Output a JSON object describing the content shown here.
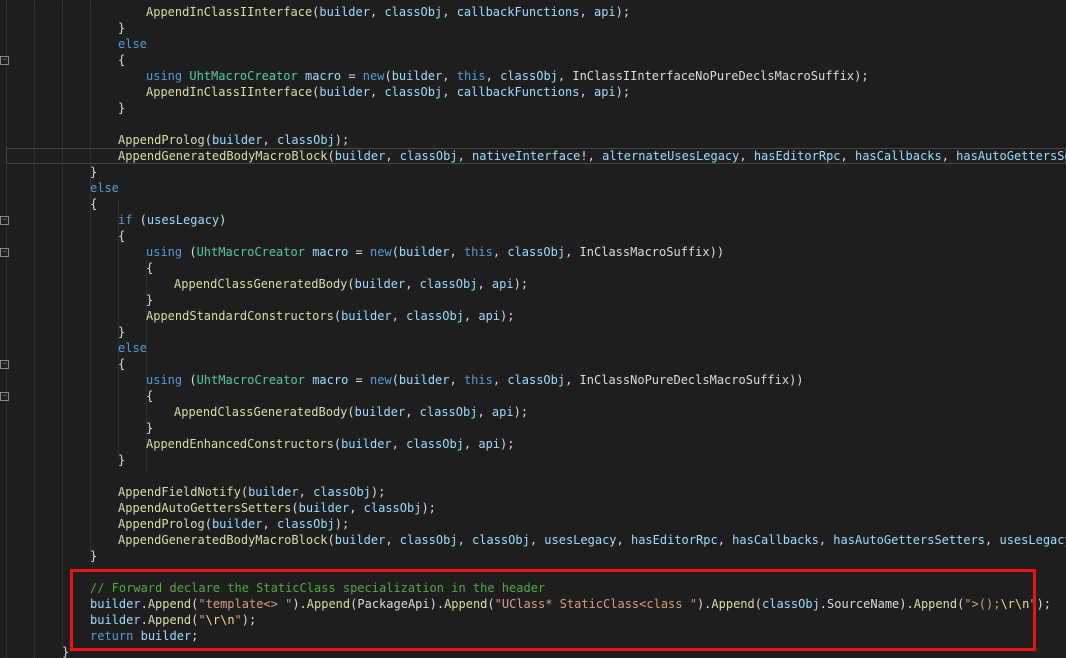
{
  "editor": {
    "lines": [
      {
        "indent": 34,
        "tokens": [
          {
            "t": "AppendInClassIInterface",
            "c": "fn"
          },
          {
            "t": "(",
            "c": "pl"
          },
          {
            "t": "builder",
            "c": "vr"
          },
          {
            "t": ", ",
            "c": "pl"
          },
          {
            "t": "classObj",
            "c": "vr"
          },
          {
            "t": ", ",
            "c": "pl"
          },
          {
            "t": "callbackFunctions",
            "c": "vr"
          },
          {
            "t": ", ",
            "c": "pl"
          },
          {
            "t": "api",
            "c": "vr"
          },
          {
            "t": ");",
            "c": "pl"
          }
        ]
      },
      {
        "indent": 30,
        "tokens": [
          {
            "t": "}",
            "c": "pl"
          }
        ]
      },
      {
        "indent": 30,
        "tokens": [
          {
            "t": "else",
            "c": "kw"
          }
        ]
      },
      {
        "indent": 30,
        "tokens": [
          {
            "t": "{",
            "c": "pl"
          }
        ]
      },
      {
        "indent": 34,
        "tokens": [
          {
            "t": "using ",
            "c": "kw"
          },
          {
            "t": "UhtMacroCreator",
            "c": "ty"
          },
          {
            "t": " ",
            "c": "pl"
          },
          {
            "t": "macro",
            "c": "vr"
          },
          {
            "t": " = ",
            "c": "pl"
          },
          {
            "t": "new",
            "c": "kw"
          },
          {
            "t": "(",
            "c": "pl"
          },
          {
            "t": "builder",
            "c": "vr"
          },
          {
            "t": ", ",
            "c": "pl"
          },
          {
            "t": "this",
            "c": "kw"
          },
          {
            "t": ", ",
            "c": "pl"
          },
          {
            "t": "classObj",
            "c": "vr"
          },
          {
            "t": ", InClassIInterfaceNoPureDeclsMacroSuffix);",
            "c": "pl"
          }
        ]
      },
      {
        "indent": 34,
        "tokens": [
          {
            "t": "AppendInClassIInterface",
            "c": "fn"
          },
          {
            "t": "(",
            "c": "pl"
          },
          {
            "t": "builder",
            "c": "vr"
          },
          {
            "t": ", ",
            "c": "pl"
          },
          {
            "t": "classObj",
            "c": "vr"
          },
          {
            "t": ", ",
            "c": "pl"
          },
          {
            "t": "callbackFunctions",
            "c": "vr"
          },
          {
            "t": ", ",
            "c": "pl"
          },
          {
            "t": "api",
            "c": "vr"
          },
          {
            "t": ");",
            "c": "pl"
          }
        ]
      },
      {
        "indent": 30,
        "tokens": [
          {
            "t": "}",
            "c": "pl"
          }
        ]
      },
      {
        "indent": 0,
        "tokens": []
      },
      {
        "indent": 30,
        "tokens": [
          {
            "t": "AppendProlog",
            "c": "fn"
          },
          {
            "t": "(",
            "c": "pl"
          },
          {
            "t": "builder",
            "c": "vr"
          },
          {
            "t": ", ",
            "c": "pl"
          },
          {
            "t": "classObj",
            "c": "vr"
          },
          {
            "t": ");",
            "c": "pl"
          }
        ]
      },
      {
        "indent": 30,
        "current": true,
        "tokens": [
          {
            "t": "AppendGeneratedBodyMacroBlock",
            "c": "fn"
          },
          {
            "t": "(",
            "c": "pl"
          },
          {
            "t": "builder",
            "c": "vr"
          },
          {
            "t": ", ",
            "c": "pl"
          },
          {
            "t": "classObj",
            "c": "vr"
          },
          {
            "t": ", ",
            "c": "pl"
          },
          {
            "t": "nativeInterface",
            "c": "vr"
          },
          {
            "t": "!, ",
            "c": "pl"
          },
          {
            "t": "alternateUsesLegacy",
            "c": "vr"
          },
          {
            "t": ", ",
            "c": "pl"
          },
          {
            "t": "hasEditorRpc",
            "c": "vr"
          },
          {
            "t": ", ",
            "c": "pl"
          },
          {
            "t": "hasCallbacks",
            "c": "vr"
          },
          {
            "t": ", ",
            "c": "pl"
          },
          {
            "t": "hasAutoGettersSetters",
            "c": "vr"
          }
        ]
      },
      {
        "indent": 26,
        "tokens": [
          {
            "t": "}",
            "c": "pl"
          }
        ]
      },
      {
        "indent": 26,
        "tokens": [
          {
            "t": "else",
            "c": "kw"
          }
        ]
      },
      {
        "indent": 26,
        "tokens": [
          {
            "t": "{",
            "c": "pl"
          }
        ]
      },
      {
        "indent": 30,
        "tokens": [
          {
            "t": "if",
            "c": "kw"
          },
          {
            "t": " (",
            "c": "pl"
          },
          {
            "t": "usesLegacy",
            "c": "vr"
          },
          {
            "t": ")",
            "c": "pl"
          }
        ]
      },
      {
        "indent": 30,
        "tokens": [
          {
            "t": "{",
            "c": "pl"
          }
        ]
      },
      {
        "indent": 34,
        "tokens": [
          {
            "t": "using",
            "c": "kw"
          },
          {
            "t": " (",
            "c": "pl"
          },
          {
            "t": "UhtMacroCreator",
            "c": "ty"
          },
          {
            "t": " ",
            "c": "pl"
          },
          {
            "t": "macro",
            "c": "vr"
          },
          {
            "t": " = ",
            "c": "pl"
          },
          {
            "t": "new",
            "c": "kw"
          },
          {
            "t": "(",
            "c": "pl"
          },
          {
            "t": "builder",
            "c": "vr"
          },
          {
            "t": ", ",
            "c": "pl"
          },
          {
            "t": "this",
            "c": "kw"
          },
          {
            "t": ", ",
            "c": "pl"
          },
          {
            "t": "classObj",
            "c": "vr"
          },
          {
            "t": ", InClassMacroSuffix))",
            "c": "pl"
          }
        ]
      },
      {
        "indent": 34,
        "tokens": [
          {
            "t": "{",
            "c": "pl"
          }
        ]
      },
      {
        "indent": 38,
        "tokens": [
          {
            "t": "AppendClassGeneratedBody",
            "c": "fn"
          },
          {
            "t": "(",
            "c": "pl"
          },
          {
            "t": "builder",
            "c": "vr"
          },
          {
            "t": ", ",
            "c": "pl"
          },
          {
            "t": "classObj",
            "c": "vr"
          },
          {
            "t": ", ",
            "c": "pl"
          },
          {
            "t": "api",
            "c": "vr"
          },
          {
            "t": ");",
            "c": "pl"
          }
        ]
      },
      {
        "indent": 34,
        "tokens": [
          {
            "t": "}",
            "c": "pl"
          }
        ]
      },
      {
        "indent": 34,
        "tokens": [
          {
            "t": "AppendStandardConstructors",
            "c": "fn"
          },
          {
            "t": "(",
            "c": "pl"
          },
          {
            "t": "builder",
            "c": "vr"
          },
          {
            "t": ", ",
            "c": "pl"
          },
          {
            "t": "classObj",
            "c": "vr"
          },
          {
            "t": ", ",
            "c": "pl"
          },
          {
            "t": "api",
            "c": "vr"
          },
          {
            "t": ");",
            "c": "pl"
          }
        ]
      },
      {
        "indent": 30,
        "tokens": [
          {
            "t": "}",
            "c": "pl"
          }
        ]
      },
      {
        "indent": 30,
        "tokens": [
          {
            "t": "else",
            "c": "kw"
          }
        ]
      },
      {
        "indent": 30,
        "tokens": [
          {
            "t": "{",
            "c": "pl"
          }
        ]
      },
      {
        "indent": 34,
        "tokens": [
          {
            "t": "using",
            "c": "kw"
          },
          {
            "t": " (",
            "c": "pl"
          },
          {
            "t": "UhtMacroCreator",
            "c": "ty"
          },
          {
            "t": " ",
            "c": "pl"
          },
          {
            "t": "macro",
            "c": "vr"
          },
          {
            "t": " = ",
            "c": "pl"
          },
          {
            "t": "new",
            "c": "kw"
          },
          {
            "t": "(",
            "c": "pl"
          },
          {
            "t": "builder",
            "c": "vr"
          },
          {
            "t": ", ",
            "c": "pl"
          },
          {
            "t": "this",
            "c": "kw"
          },
          {
            "t": ", ",
            "c": "pl"
          },
          {
            "t": "classObj",
            "c": "vr"
          },
          {
            "t": ", InClassNoPureDeclsMacroSuffix))",
            "c": "pl"
          }
        ]
      },
      {
        "indent": 34,
        "tokens": [
          {
            "t": "{",
            "c": "pl"
          }
        ]
      },
      {
        "indent": 38,
        "tokens": [
          {
            "t": "AppendClassGeneratedBody",
            "c": "fn"
          },
          {
            "t": "(",
            "c": "pl"
          },
          {
            "t": "builder",
            "c": "vr"
          },
          {
            "t": ", ",
            "c": "pl"
          },
          {
            "t": "classObj",
            "c": "vr"
          },
          {
            "t": ", ",
            "c": "pl"
          },
          {
            "t": "api",
            "c": "vr"
          },
          {
            "t": ");",
            "c": "pl"
          }
        ]
      },
      {
        "indent": 34,
        "tokens": [
          {
            "t": "}",
            "c": "pl"
          }
        ]
      },
      {
        "indent": 34,
        "tokens": [
          {
            "t": "AppendEnhancedConstructors",
            "c": "fn"
          },
          {
            "t": "(",
            "c": "pl"
          },
          {
            "t": "builder",
            "c": "vr"
          },
          {
            "t": ", ",
            "c": "pl"
          },
          {
            "t": "classObj",
            "c": "vr"
          },
          {
            "t": ", ",
            "c": "pl"
          },
          {
            "t": "api",
            "c": "vr"
          },
          {
            "t": ");",
            "c": "pl"
          }
        ]
      },
      {
        "indent": 30,
        "tokens": [
          {
            "t": "}",
            "c": "pl"
          }
        ]
      },
      {
        "indent": 0,
        "tokens": []
      },
      {
        "indent": 30,
        "tokens": [
          {
            "t": "AppendFieldNotify",
            "c": "fn"
          },
          {
            "t": "(",
            "c": "pl"
          },
          {
            "t": "builder",
            "c": "vr"
          },
          {
            "t": ", ",
            "c": "pl"
          },
          {
            "t": "classObj",
            "c": "vr"
          },
          {
            "t": ");",
            "c": "pl"
          }
        ]
      },
      {
        "indent": 30,
        "tokens": [
          {
            "t": "AppendAutoGettersSetters",
            "c": "fn"
          },
          {
            "t": "(",
            "c": "pl"
          },
          {
            "t": "builder",
            "c": "vr"
          },
          {
            "t": ", ",
            "c": "pl"
          },
          {
            "t": "classObj",
            "c": "vr"
          },
          {
            "t": ");",
            "c": "pl"
          }
        ]
      },
      {
        "indent": 30,
        "tokens": [
          {
            "t": "AppendProlog",
            "c": "fn"
          },
          {
            "t": "(",
            "c": "pl"
          },
          {
            "t": "builder",
            "c": "vr"
          },
          {
            "t": ", ",
            "c": "pl"
          },
          {
            "t": "classObj",
            "c": "vr"
          },
          {
            "t": ");",
            "c": "pl"
          }
        ]
      },
      {
        "indent": 30,
        "tokens": [
          {
            "t": "AppendGeneratedBodyMacroBlock",
            "c": "fn"
          },
          {
            "t": "(",
            "c": "pl"
          },
          {
            "t": "builder",
            "c": "vr"
          },
          {
            "t": ", ",
            "c": "pl"
          },
          {
            "t": "classObj",
            "c": "vr"
          },
          {
            "t": ", ",
            "c": "pl"
          },
          {
            "t": "classObj",
            "c": "vr"
          },
          {
            "t": ", ",
            "c": "pl"
          },
          {
            "t": "usesLegacy",
            "c": "vr"
          },
          {
            "t": ", ",
            "c": "pl"
          },
          {
            "t": "hasEditorRpc",
            "c": "vr"
          },
          {
            "t": ", ",
            "c": "pl"
          },
          {
            "t": "hasCallbacks",
            "c": "vr"
          },
          {
            "t": ", ",
            "c": "pl"
          },
          {
            "t": "hasAutoGettersSetters",
            "c": "vr"
          },
          {
            "t": ", ",
            "c": "pl"
          },
          {
            "t": "usesLegacy",
            "c": "vr"
          },
          {
            "t": " ? ",
            "c": "pl"
          }
        ]
      },
      {
        "indent": 26,
        "tokens": [
          {
            "t": "}",
            "c": "pl"
          }
        ]
      },
      {
        "indent": 0,
        "tokens": []
      },
      {
        "indent": 26,
        "tokens": [
          {
            "t": "// Forward declare the StaticClass specialization in the header",
            "c": "cm"
          }
        ]
      },
      {
        "indent": 26,
        "tokens": [
          {
            "t": "builder",
            "c": "vr"
          },
          {
            "t": ".",
            "c": "pl"
          },
          {
            "t": "Append",
            "c": "fn"
          },
          {
            "t": "(",
            "c": "pl"
          },
          {
            "t": "\"template<> \"",
            "c": "st"
          },
          {
            "t": ").",
            "c": "pl"
          },
          {
            "t": "Append",
            "c": "fn"
          },
          {
            "t": "(PackageApi).",
            "c": "pl"
          },
          {
            "t": "Append",
            "c": "fn"
          },
          {
            "t": "(",
            "c": "pl"
          },
          {
            "t": "\"UClass* StaticClass<class \"",
            "c": "st"
          },
          {
            "t": ").",
            "c": "pl"
          },
          {
            "t": "Append",
            "c": "fn"
          },
          {
            "t": "(",
            "c": "pl"
          },
          {
            "t": "classObj",
            "c": "vr"
          },
          {
            "t": ".SourceName).",
            "c": "pl"
          },
          {
            "t": "Append",
            "c": "fn"
          },
          {
            "t": "(",
            "c": "pl"
          },
          {
            "t": "\">();",
            "c": "st"
          },
          {
            "t": "\\r\\n",
            "c": "es"
          },
          {
            "t": "\"",
            "c": "st"
          },
          {
            "t": ");",
            "c": "pl"
          }
        ]
      },
      {
        "indent": 26,
        "tokens": [
          {
            "t": "builder",
            "c": "vr"
          },
          {
            "t": ".",
            "c": "pl"
          },
          {
            "t": "Append",
            "c": "fn"
          },
          {
            "t": "(",
            "c": "pl"
          },
          {
            "t": "\"",
            "c": "st"
          },
          {
            "t": "\\r\\n",
            "c": "es"
          },
          {
            "t": "\"",
            "c": "st"
          },
          {
            "t": ");",
            "c": "pl"
          }
        ]
      },
      {
        "indent": 26,
        "tokens": [
          {
            "t": "return",
            "c": "kw"
          },
          {
            "t": " ",
            "c": "pl"
          },
          {
            "t": "builder",
            "c": "vr"
          },
          {
            "t": ";",
            "c": "pl"
          }
        ]
      },
      {
        "indent": 22,
        "tokens": [
          {
            "t": "}",
            "c": "pl"
          }
        ]
      }
    ]
  },
  "folds": [
    3,
    13,
    15,
    22,
    24
  ],
  "annotation": {
    "color": "#e8121a"
  }
}
